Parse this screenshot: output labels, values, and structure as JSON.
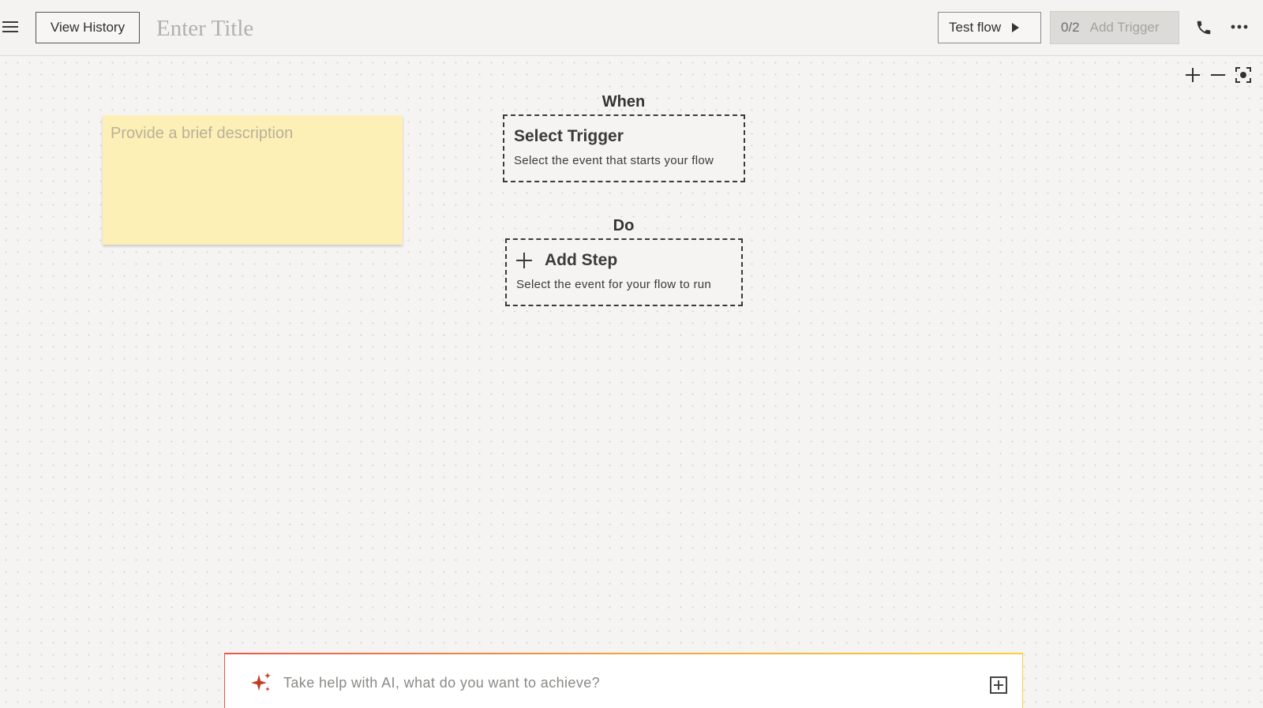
{
  "header": {
    "view_history_label": "View History",
    "title_placeholder": "Enter Title",
    "test_flow_label": "Test flow",
    "trigger_count": "0/2",
    "add_trigger_label": "Add Trigger"
  },
  "note": {
    "placeholder": "Provide a brief description"
  },
  "flow": {
    "when_label": "When",
    "trigger_node": {
      "title": "Select Trigger",
      "subtitle": "Select the event that starts your flow"
    },
    "do_label": "Do",
    "step_node": {
      "title": "Add Step",
      "subtitle": "Select the event for your flow to run"
    }
  },
  "ai_bar": {
    "placeholder": "Take help with AI, what do you want to achieve?"
  },
  "colors": {
    "note_background": "#fdf0b6",
    "ai_spark": "#c23b22",
    "canvas_background": "#f5f4f2"
  },
  "icons": [
    "menu-icon",
    "play-icon",
    "phone-icon",
    "more-icon",
    "zoom-in-icon",
    "zoom-out-icon",
    "fit-view-icon",
    "sparkle-icon",
    "attach-icon",
    "plus-icon"
  ]
}
